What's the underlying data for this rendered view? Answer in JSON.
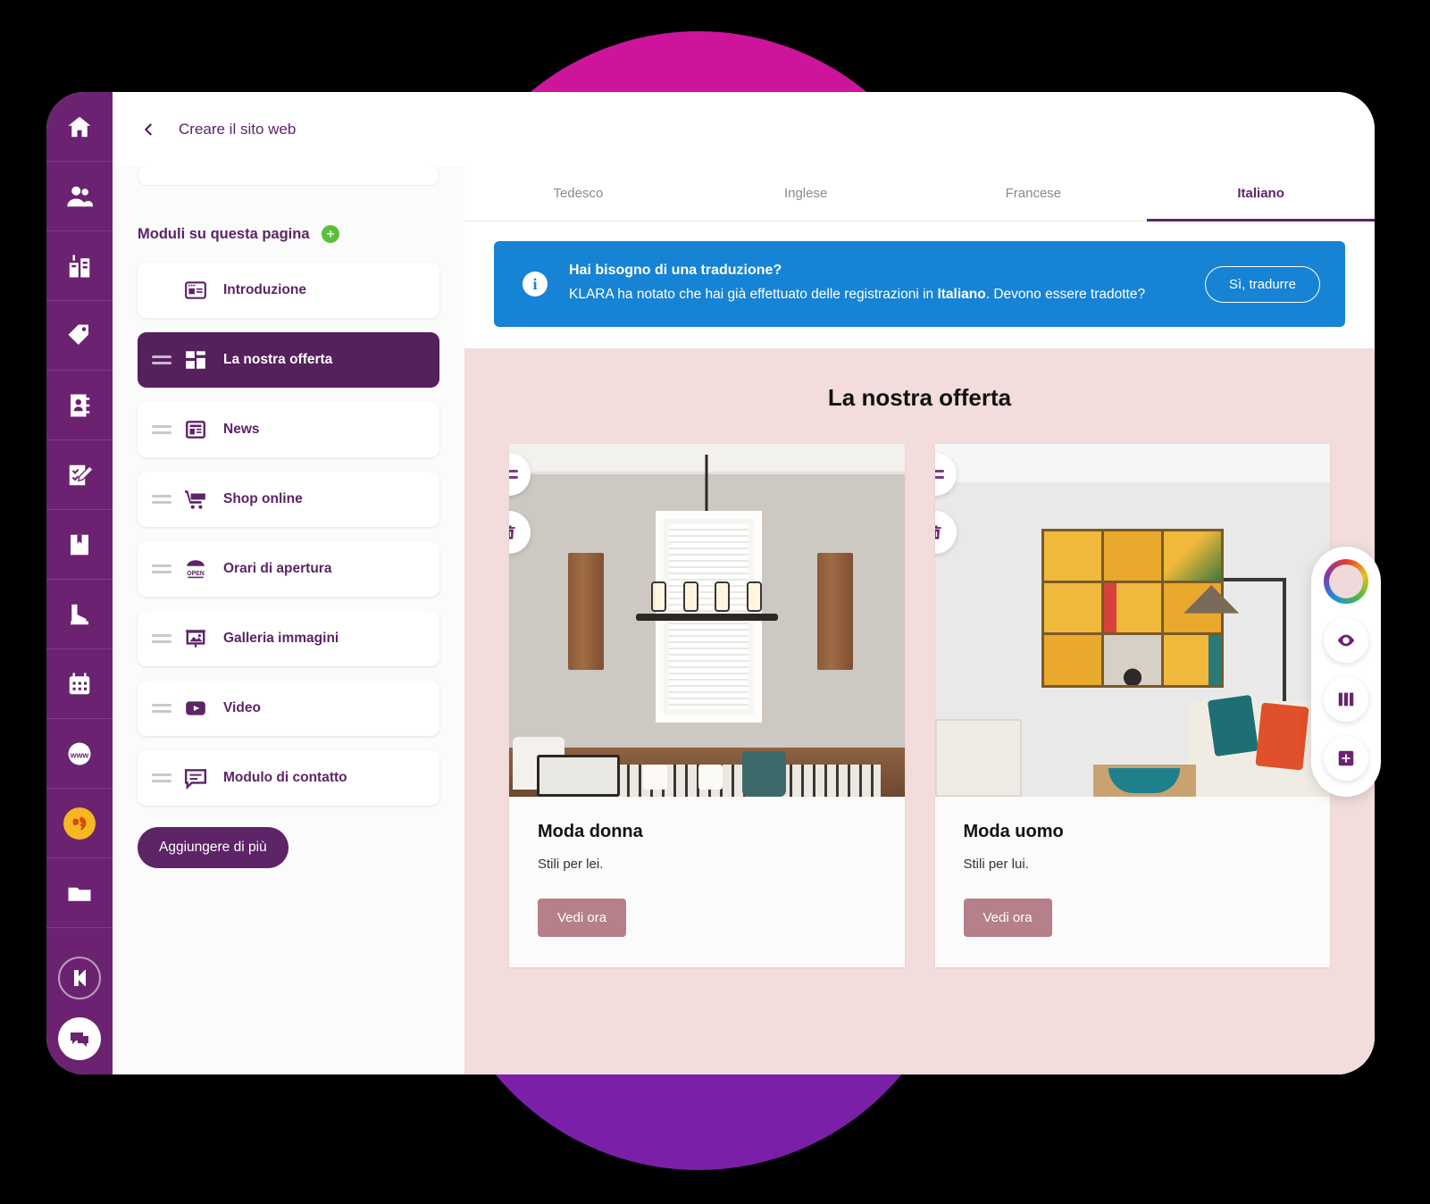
{
  "decor": {
    "top_circle_color": "#cc159b",
    "bottom_circle_color": "#7b1fa8"
  },
  "rail": {
    "items": [
      {
        "name": "home-icon",
        "label": "Home"
      },
      {
        "name": "people-icon",
        "label": "Contatti"
      },
      {
        "name": "building-icon",
        "label": "Azienda"
      },
      {
        "name": "tag-icon",
        "label": "Prodotti"
      },
      {
        "name": "address-book-icon",
        "label": "Rubrica"
      },
      {
        "name": "checklist-edit-icon",
        "label": "Attività"
      },
      {
        "name": "book-bookmark-icon",
        "label": "Catalogo"
      },
      {
        "name": "boot-icon",
        "label": "Magazzino"
      },
      {
        "name": "calendar-icon",
        "label": "Calendario"
      },
      {
        "name": "www-globe-icon",
        "label": "Sito web"
      },
      {
        "name": "badge-icon",
        "label": "Novità"
      },
      {
        "name": "folder-icon",
        "label": "Archivio"
      }
    ],
    "logo": "klara-logo-icon",
    "chat": "chat-bubbles-icon"
  },
  "topbar": {
    "back": "back-chevron-icon",
    "title": "Creare il sito web"
  },
  "module_panel": {
    "heading": "Moduli su questa pagina",
    "add_icon": "plus-circle-icon",
    "items": [
      {
        "label": "Introduzione",
        "icon": "intro-page-icon",
        "active": false,
        "draggable": false
      },
      {
        "label": "La nostra offerta",
        "icon": "grid-blocks-icon",
        "active": true,
        "draggable": true
      },
      {
        "label": "News",
        "icon": "newspaper-icon",
        "active": false,
        "draggable": true
      },
      {
        "label": "Shop online",
        "icon": "shopping-cart-icon",
        "active": false,
        "draggable": true
      },
      {
        "label": "Orari di apertura",
        "icon": "open-sign-icon",
        "active": false,
        "draggable": true
      },
      {
        "label": "Galleria immagini",
        "icon": "image-gallery-icon",
        "active": false,
        "draggable": true
      },
      {
        "label": "Video",
        "icon": "video-play-icon",
        "active": false,
        "draggable": true
      },
      {
        "label": "Modulo di contatto",
        "icon": "contact-form-icon",
        "active": false,
        "draggable": true
      }
    ],
    "add_more_label": "Aggiungere di più"
  },
  "language_tabs": [
    {
      "label": "Tedesco",
      "active": false
    },
    {
      "label": "Inglese",
      "active": false
    },
    {
      "label": "Francese",
      "active": false
    },
    {
      "label": "Italiano",
      "active": true
    }
  ],
  "banner": {
    "color": "#1783d4",
    "info_icon": "info-circle-icon",
    "info_glyph": "i",
    "title": "Hai bisogno di una traduzione?",
    "body_part1": "KLARA ha notato che hai già effettuato delle registrazioni in ",
    "body_bold": "Italiano",
    "body_part2": ". Devono essere tradotte?",
    "button_label": "Sì, tradurre"
  },
  "canvas": {
    "background_color": "#f2dcdc",
    "title": "La nostra offerta",
    "cards": [
      {
        "title": "Moda donna",
        "subtitle": "Stili per lei.",
        "button_label": "Vedi ora",
        "photo_alt": "Sala da pranzo con lampadario e finestra",
        "drag_icon": "drag-handle-icon",
        "delete_icon": "trash-icon"
      },
      {
        "title": "Moda uomo",
        "subtitle": "Stili per lui.",
        "button_label": "Vedi ora",
        "photo_alt": "Soggiorno con quadro giallo a griglia e divano",
        "drag_icon": "drag-handle-icon",
        "delete_icon": "trash-icon"
      }
    ],
    "button_color": "#b5808a"
  },
  "float_toolbar": [
    {
      "name": "color-wheel-button",
      "icon": "color-wheel-icon"
    },
    {
      "name": "preview-button",
      "icon": "eye-icon"
    },
    {
      "name": "layout-columns-button",
      "icon": "columns-icon"
    },
    {
      "name": "add-section-button",
      "icon": "plus-square-icon"
    }
  ]
}
